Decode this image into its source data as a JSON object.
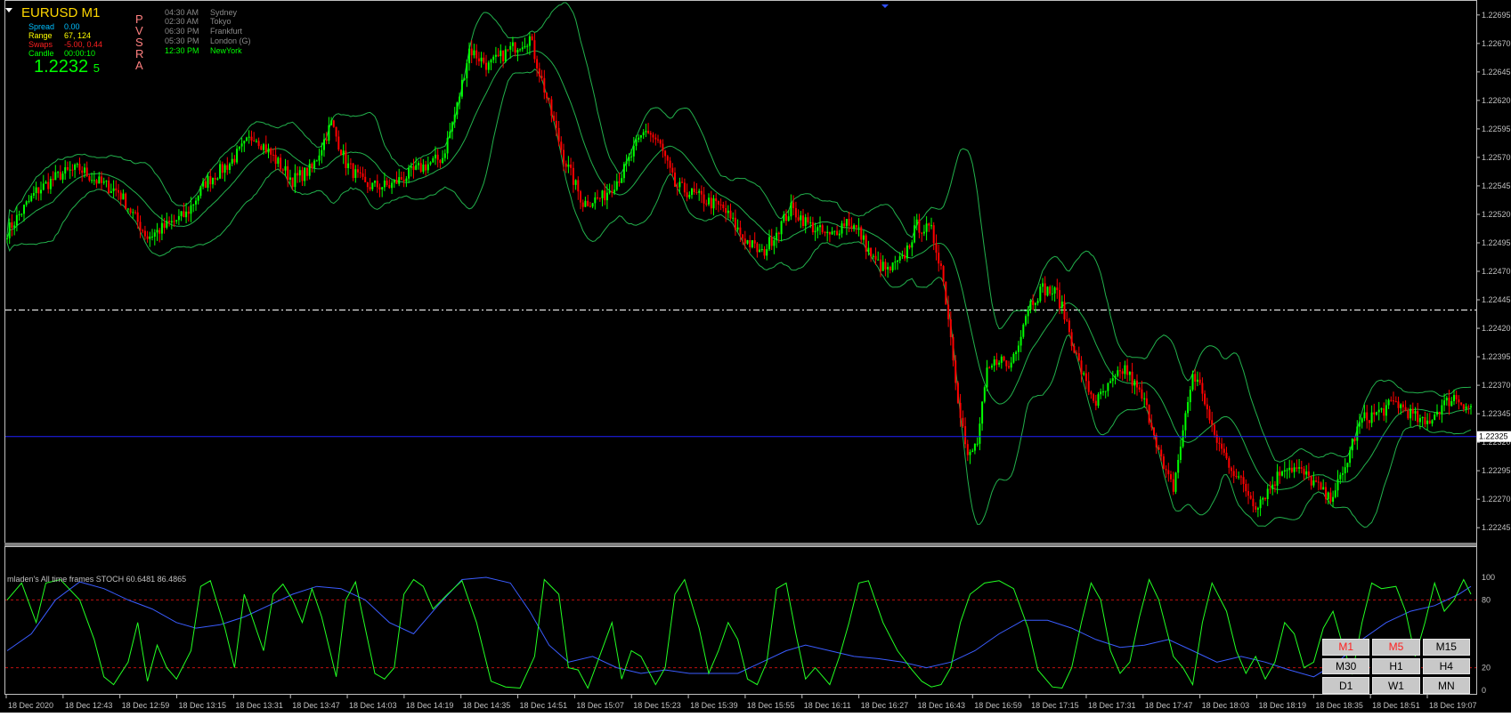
{
  "window": {
    "symbol_title": "EURUSD   M1"
  },
  "info_panel": {
    "items": [
      {
        "label": "Spread",
        "value": "0.00",
        "label_color": "#00bfff",
        "value_color": "#00bfff"
      },
      {
        "label": "Range",
        "value": "67, 124",
        "label_color": "#ffff00",
        "value_color": "#ffff00"
      },
      {
        "label": "Swaps",
        "value": "-5.00, 0.44",
        "label_color": "#ff2020",
        "value_color": "#ff2020"
      },
      {
        "label": "Candle",
        "value": "00:00:10",
        "label_color": "#00ff00",
        "value_color": "#00ff00"
      }
    ],
    "price_main": "1.2232",
    "price_small": "5"
  },
  "pvsra": [
    "P",
    "V",
    "S",
    "R",
    "A"
  ],
  "sessions": [
    {
      "time": "04:30 AM",
      "name": "Sydney",
      "color": "#8a8a8a"
    },
    {
      "time": "02:30 AM",
      "name": "Tokyo",
      "color": "#8a8a8a"
    },
    {
      "time": "06:30 PM",
      "name": "Frankfurt",
      "color": "#8a8a8a"
    },
    {
      "time": "05:30 PM",
      "name": "London  (G)",
      "color": "#8a8a8a"
    },
    {
      "time": "12:30 PM",
      "name": "NewYork",
      "color": "#00ff00"
    }
  ],
  "colors": {
    "bull": "#00ff00",
    "bear": "#ff0000",
    "band": "#22b14c",
    "bid_line": "#2020ff",
    "pivot_line": "#ffffff",
    "stoch_fast": "#22ff22",
    "stoch_slow": "#3a5cff",
    "stoch_levels": "#c01010",
    "grid_frame": "#c0c0c0"
  },
  "price_axis": {
    "ticks": [
      "1.22695",
      "1.22670",
      "1.22645",
      "1.22620",
      "1.22595",
      "1.22570",
      "1.22545",
      "1.22520",
      "1.22495",
      "1.22470",
      "1.22445",
      "1.22420",
      "1.22395",
      "1.22370",
      "1.22345",
      "1.22320",
      "1.22295",
      "1.22270",
      "1.22245"
    ],
    "current_price_label": "1.22325"
  },
  "time_axis": {
    "labels": [
      "18 Dec 2020",
      "18 Dec 12:43",
      "18 Dec 12:59",
      "18 Dec 13:15",
      "18 Dec 13:31",
      "18 Dec 13:47",
      "18 Dec 14:03",
      "18 Dec 14:19",
      "18 Dec 14:35",
      "18 Dec 14:51",
      "18 Dec 15:07",
      "18 Dec 15:23",
      "18 Dec 15:39",
      "18 Dec 15:55",
      "18 Dec 16:11",
      "18 Dec 16:27",
      "18 Dec 16:43",
      "18 Dec 16:59",
      "18 Dec 17:15",
      "18 Dec 17:31",
      "18 Dec 17:47",
      "18 Dec 18:03",
      "18 Dec 18:19",
      "18 Dec 18:35",
      "18 Dec 18:51",
      "18 Dec 19:07"
    ]
  },
  "stoch_panel": {
    "label": "mladen's  All time frames STOCH 60.6481 86.4865",
    "levels": [
      "100",
      "80",
      "20",
      "0"
    ]
  },
  "timeframe_buttons": [
    {
      "label": "M1",
      "active": true
    },
    {
      "label": "M5",
      "active": true
    },
    {
      "label": "M15",
      "active": false
    },
    {
      "label": "M30",
      "active": false
    },
    {
      "label": "H1",
      "active": false
    },
    {
      "label": "H4",
      "active": false
    },
    {
      "label": "D1",
      "active": false
    },
    {
      "label": "W1",
      "active": false
    },
    {
      "label": "MN",
      "active": false
    }
  ],
  "chart_data": {
    "type": "candlestick",
    "symbol": "EURUSD",
    "timeframe": "M1",
    "ylim": [
      1.22235,
      1.22705
    ],
    "bid": 1.22325,
    "pivot_level": 1.22436,
    "price_path": [
      [
        0,
        1.22505
      ],
      [
        12,
        1.2254
      ],
      [
        22,
        1.22555
      ],
      [
        30,
        1.2256
      ],
      [
        38,
        1.22548
      ],
      [
        46,
        1.2254
      ],
      [
        52,
        1.2252
      ],
      [
        58,
        1.225
      ],
      [
        66,
        1.2251
      ],
      [
        74,
        1.2252
      ],
      [
        82,
        1.22548
      ],
      [
        92,
        1.22565
      ],
      [
        102,
        1.2259
      ],
      [
        110,
        1.2257
      ],
      [
        118,
        1.2255
      ],
      [
        126,
        1.2256
      ],
      [
        134,
        1.226
      ],
      [
        140,
        1.22565
      ],
      [
        148,
        1.22545
      ],
      [
        158,
        1.22545
      ],
      [
        170,
        1.2256
      ],
      [
        180,
        1.2257
      ],
      [
        186,
        1.22615
      ],
      [
        191,
        1.22665
      ],
      [
        199,
        1.2265
      ],
      [
        208,
        1.22665
      ],
      [
        216,
        1.22675
      ],
      [
        222,
        1.2263
      ],
      [
        230,
        1.2257
      ],
      [
        238,
        1.2253
      ],
      [
        246,
        1.22535
      ],
      [
        254,
        1.22555
      ],
      [
        260,
        1.2258
      ],
      [
        264,
        1.22595
      ],
      [
        270,
        1.2258
      ],
      [
        276,
        1.22545
      ],
      [
        286,
        1.22535
      ],
      [
        296,
        1.22525
      ],
      [
        304,
        1.225
      ],
      [
        312,
        1.22485
      ],
      [
        318,
        1.22505
      ],
      [
        324,
        1.22525
      ],
      [
        332,
        1.2251
      ],
      [
        340,
        1.225
      ],
      [
        347,
        1.22515
      ],
      [
        352,
        1.22505
      ],
      [
        358,
        1.2248
      ],
      [
        364,
        1.2247
      ],
      [
        370,
        1.2248
      ],
      [
        376,
        1.2251
      ],
      [
        382,
        1.22505
      ],
      [
        386,
        1.22475
      ],
      [
        389,
        1.2243
      ],
      [
        393,
        1.2236
      ],
      [
        397,
        1.22305
      ],
      [
        401,
        1.2232
      ],
      [
        405,
        1.2238
      ],
      [
        410,
        1.22395
      ],
      [
        414,
        1.22385
      ],
      [
        418,
        1.2241
      ],
      [
        422,
        1.2244
      ],
      [
        428,
        1.22455
      ],
      [
        434,
        1.2245
      ],
      [
        438,
        1.22425
      ],
      [
        442,
        1.22395
      ],
      [
        446,
        1.2237
      ],
      [
        450,
        1.22355
      ],
      [
        456,
        1.2237
      ],
      [
        462,
        1.22385
      ],
      [
        466,
        1.2237
      ],
      [
        470,
        1.22355
      ],
      [
        474,
        1.2233
      ],
      [
        478,
        1.22295
      ],
      [
        482,
        1.2228
      ],
      [
        486,
        1.2233
      ],
      [
        490,
        1.2238
      ],
      [
        494,
        1.22365
      ],
      [
        498,
        1.2233
      ],
      [
        504,
        1.22305
      ],
      [
        510,
        1.22285
      ],
      [
        516,
        1.22265
      ],
      [
        522,
        1.2228
      ],
      [
        528,
        1.223
      ],
      [
        534,
        1.22295
      ],
      [
        540,
        1.22285
      ],
      [
        546,
        1.2227
      ],
      [
        552,
        1.2229
      ],
      [
        556,
        1.2232
      ],
      [
        560,
        1.2234
      ],
      [
        566,
        1.22345
      ],
      [
        574,
        1.22355
      ],
      [
        580,
        1.22345
      ],
      [
        586,
        1.22335
      ],
      [
        592,
        1.2235
      ],
      [
        598,
        1.2236
      ],
      [
        605,
        1.2235
      ]
    ],
    "series": [
      {
        "name": "price",
        "kind": "candles"
      },
      {
        "name": "upper band",
        "kind": "line"
      },
      {
        "name": "middle band",
        "kind": "line"
      },
      {
        "name": "lower band",
        "kind": "line"
      }
    ],
    "stochastic": {
      "ylim": [
        0,
        100
      ],
      "levels": [
        80,
        20
      ],
      "fast": [
        [
          0,
          80
        ],
        [
          6,
          95
        ],
        [
          12,
          60
        ],
        [
          16,
          95
        ],
        [
          22,
          98
        ],
        [
          30,
          80
        ],
        [
          36,
          45
        ],
        [
          40,
          12
        ],
        [
          44,
          5
        ],
        [
          50,
          25
        ],
        [
          54,
          60
        ],
        [
          58,
          8
        ],
        [
          62,
          40
        ],
        [
          66,
          20
        ],
        [
          70,
          10
        ],
        [
          76,
          35
        ],
        [
          80,
          92
        ],
        [
          84,
          97
        ],
        [
          90,
          55
        ],
        [
          94,
          20
        ],
        [
          98,
          85
        ],
        [
          102,
          60
        ],
        [
          106,
          35
        ],
        [
          110,
          85
        ],
        [
          114,
          94
        ],
        [
          118,
          80
        ],
        [
          122,
          60
        ],
        [
          126,
          90
        ],
        [
          130,
          65
        ],
        [
          136,
          12
        ],
        [
          140,
          80
        ],
        [
          144,
          96
        ],
        [
          148,
          55
        ],
        [
          152,
          15
        ],
        [
          156,
          10
        ],
        [
          160,
          20
        ],
        [
          164,
          85
        ],
        [
          168,
          98
        ],
        [
          172,
          92
        ],
        [
          176,
          72
        ],
        [
          182,
          85
        ],
        [
          188,
          97
        ],
        [
          194,
          60
        ],
        [
          200,
          8
        ],
        [
          206,
          3
        ],
        [
          212,
          2
        ],
        [
          218,
          30
        ],
        [
          222,
          98
        ],
        [
          228,
          85
        ],
        [
          232,
          20
        ],
        [
          236,
          18
        ],
        [
          240,
          2
        ],
        [
          244,
          25
        ],
        [
          250,
          60
        ],
        [
          254,
          10
        ],
        [
          258,
          35
        ],
        [
          262,
          30
        ],
        [
          268,
          5
        ],
        [
          272,
          20
        ],
        [
          276,
          85
        ],
        [
          280,
          98
        ],
        [
          286,
          55
        ],
        [
          290,
          15
        ],
        [
          294,
          35
        ],
        [
          298,
          60
        ],
        [
          302,
          45
        ],
        [
          306,
          10
        ],
        [
          310,
          5
        ],
        [
          314,
          25
        ],
        [
          318,
          90
        ],
        [
          322,
          95
        ],
        [
          326,
          50
        ],
        [
          330,
          10
        ],
        [
          334,
          20
        ],
        [
          340,
          5
        ],
        [
          344,
          30
        ],
        [
          348,
          60
        ],
        [
          352,
          95
        ],
        [
          356,
          97
        ],
        [
          362,
          60
        ],
        [
          368,
          35
        ],
        [
          374,
          18
        ],
        [
          378,
          8
        ],
        [
          382,
          3
        ],
        [
          386,
          5
        ],
        [
          390,
          20
        ],
        [
          394,
          60
        ],
        [
          398,
          85
        ],
        [
          404,
          95
        ],
        [
          410,
          97
        ],
        [
          416,
          90
        ],
        [
          422,
          55
        ],
        [
          426,
          18
        ],
        [
          432,
          3
        ],
        [
          436,
          2
        ],
        [
          440,
          20
        ],
        [
          444,
          60
        ],
        [
          448,
          95
        ],
        [
          452,
          80
        ],
        [
          456,
          35
        ],
        [
          460,
          15
        ],
        [
          464,
          25
        ],
        [
          468,
          65
        ],
        [
          472,
          98
        ],
        [
          476,
          80
        ],
        [
          482,
          30
        ],
        [
          486,
          20
        ],
        [
          490,
          5
        ],
        [
          494,
          60
        ],
        [
          498,
          95
        ],
        [
          504,
          70
        ],
        [
          508,
          35
        ],
        [
          512,
          15
        ],
        [
          516,
          30
        ],
        [
          520,
          10
        ],
        [
          524,
          25
        ],
        [
          528,
          60
        ],
        [
          532,
          50
        ],
        [
          536,
          20
        ],
        [
          540,
          25
        ],
        [
          544,
          55
        ],
        [
          548,
          70
        ],
        [
          552,
          40
        ],
        [
          556,
          15
        ],
        [
          560,
          60
        ],
        [
          564,
          95
        ],
        [
          568,
          90
        ],
        [
          574,
          92
        ],
        [
          578,
          70
        ],
        [
          582,
          30
        ],
        [
          586,
          60
        ],
        [
          590,
          95
        ],
        [
          594,
          70
        ],
        [
          598,
          80
        ],
        [
          602,
          98
        ],
        [
          605,
          85
        ]
      ],
      "slow": [
        [
          0,
          35
        ],
        [
          10,
          50
        ],
        [
          20,
          80
        ],
        [
          30,
          96
        ],
        [
          40,
          90
        ],
        [
          50,
          80
        ],
        [
          60,
          72
        ],
        [
          70,
          60
        ],
        [
          78,
          55
        ],
        [
          88,
          58
        ],
        [
          98,
          65
        ],
        [
          108,
          75
        ],
        [
          118,
          85
        ],
        [
          128,
          92
        ],
        [
          138,
          90
        ],
        [
          148,
          80
        ],
        [
          158,
          60
        ],
        [
          168,
          50
        ],
        [
          178,
          75
        ],
        [
          188,
          98
        ],
        [
          198,
          100
        ],
        [
          208,
          95
        ],
        [
          216,
          70
        ],
        [
          224,
          40
        ],
        [
          232,
          25
        ],
        [
          242,
          30
        ],
        [
          252,
          20
        ],
        [
          262,
          15
        ],
        [
          272,
          18
        ],
        [
          282,
          15
        ],
        [
          292,
          15
        ],
        [
          302,
          15
        ],
        [
          312,
          25
        ],
        [
          322,
          35
        ],
        [
          330,
          40
        ],
        [
          340,
          35
        ],
        [
          350,
          30
        ],
        [
          360,
          28
        ],
        [
          370,
          25
        ],
        [
          380,
          20
        ],
        [
          390,
          25
        ],
        [
          400,
          35
        ],
        [
          410,
          50
        ],
        [
          420,
          62
        ],
        [
          430,
          62
        ],
        [
          440,
          55
        ],
        [
          450,
          45
        ],
        [
          460,
          38
        ],
        [
          470,
          40
        ],
        [
          480,
          45
        ],
        [
          490,
          35
        ],
        [
          500,
          25
        ],
        [
          510,
          30
        ],
        [
          520,
          25
        ],
        [
          530,
          18
        ],
        [
          540,
          12
        ],
        [
          550,
          25
        ],
        [
          560,
          45
        ],
        [
          570,
          60
        ],
        [
          580,
          70
        ],
        [
          590,
          75
        ],
        [
          600,
          85
        ],
        [
          605,
          92
        ]
      ]
    }
  }
}
